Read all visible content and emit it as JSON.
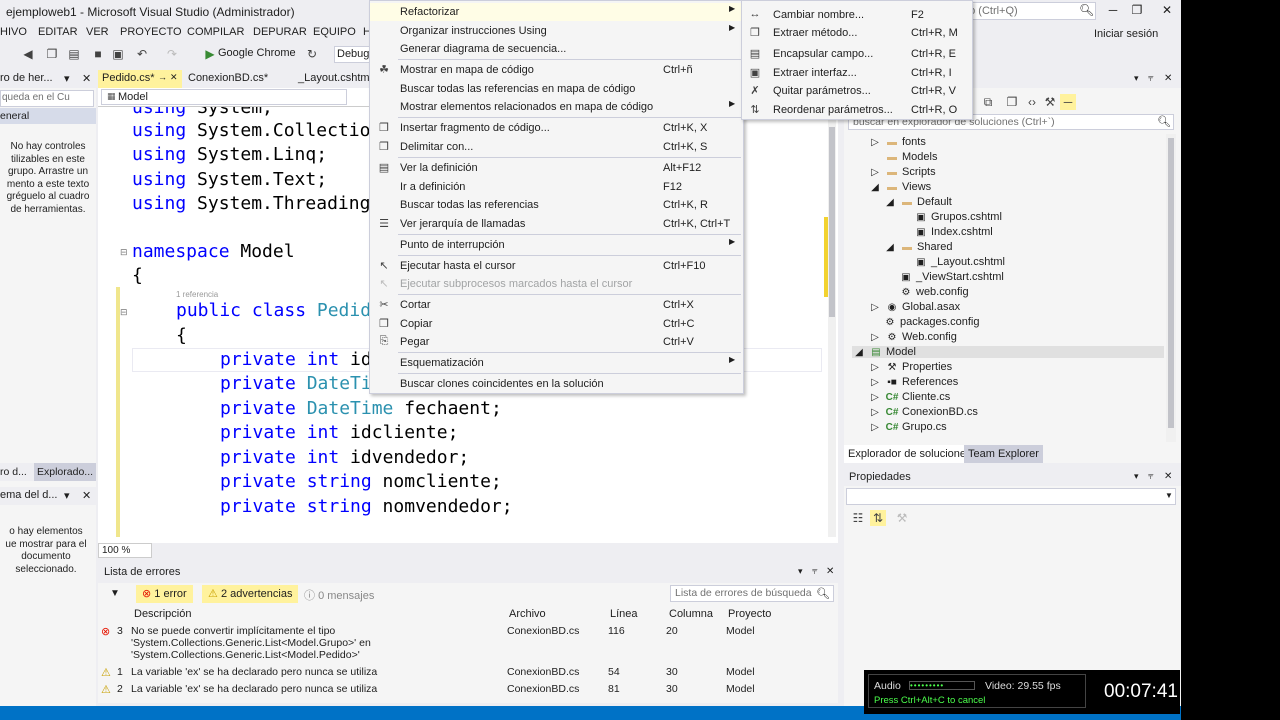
{
  "window": {
    "title": "ejemploweb1 - Microsoft Visual Studio (Administrador)",
    "quick_launch_placeholder": "do (Ctrl+Q)",
    "sign_in": "Iniciar sesión"
  },
  "menu": [
    "HIVO",
    "EDITAR",
    "VER",
    "PROYECTO",
    "COMPILAR",
    "DEPURAR",
    "EQUIPO",
    "H"
  ],
  "toolbar": {
    "browser": "Google Chrome",
    "config": "Debug"
  },
  "left_pane": {
    "toolbox_header": "ro de her...",
    "search_placeholder": "queda en el Cu",
    "general": "eneral",
    "empty_msg": [
      "No hay controles",
      "tilizables en este",
      "grupo. Arrastre un",
      "mento a este texto",
      "gréguelo al cuadro",
      "de herramientas."
    ],
    "tabs": [
      "ro d...",
      "Explorado..."
    ],
    "outline_header": "ema del d...",
    "outline_msg": [
      "o hay elementos",
      "ue mostrar para el",
      "documento",
      "seleccionado."
    ]
  },
  "doc_tabs": {
    "active": "Pedido.cs*",
    "tab2": "ConexionBD.cs*",
    "tab3": "_Layout.cshtml"
  },
  "navbar": {
    "project": "Model"
  },
  "code": {
    "lines": [
      {
        "kw": "using",
        "rest": " System;"
      },
      {
        "kw": "using",
        "rest": " System.Collectio"
      },
      {
        "kw": "using",
        "rest": " System.Linq;"
      },
      {
        "kw": "using",
        "rest": " System.Text;"
      },
      {
        "kw": "using",
        "rest": " System.Threading"
      },
      {
        "kw": "namespace",
        "rest": " Model"
      },
      {
        "kw": "",
        "rest": "{"
      },
      {
        "kw": "public class",
        "ty": " Pedid"
      },
      {
        "kw": "",
        "rest": "{"
      },
      {
        "kw": "private",
        "kw2": " int",
        "rest": " id"
      },
      {
        "kw": "private",
        "ty": " DateTi"
      },
      {
        "kw": "private",
        "ty": " DateTime",
        "rest": " fechaent;"
      },
      {
        "kw": "private",
        "kw2": " int",
        "rest": " idcliente;"
      },
      {
        "kw": "private",
        "kw2": " int",
        "rest": " idvendedor;"
      },
      {
        "kw": "private",
        "kw2": " string",
        "rest": " nomcliente;"
      },
      {
        "kw": "private",
        "kw2": " string",
        "rest": " nomvendedor;"
      }
    ],
    "ref_hint": "1 referencia"
  },
  "zoom": "100 %",
  "error_list": {
    "title": "Lista de errores",
    "errors_btn": "1 error",
    "warnings_btn": "2 advertencias",
    "messages_btn": "0 mensajes",
    "search_placeholder": "Lista de errores de búsqueda",
    "columns": [
      "Descripción",
      "Archivo",
      "Línea",
      "Columna",
      "Proyecto"
    ],
    "rows": [
      {
        "num": "3",
        "desc": [
          "No se puede convertir implícitamente el tipo",
          "'System.Collections.Generic.List<Model.Grupo>' en",
          "'System.Collections.Generic.List<Model.Pedido>'"
        ],
        "file": "ConexionBD.cs",
        "line": "116",
        "col": "20",
        "project": "Model"
      },
      {
        "num": "1",
        "desc": [
          "La variable 'ex' se ha declarado pero nunca se utiliza"
        ],
        "file": "ConexionBD.cs",
        "line": "54",
        "col": "30",
        "project": "Model"
      },
      {
        "num": "2",
        "desc": [
          "La variable 'ex' se ha declarado pero nunca se utiliza"
        ],
        "file": "ConexionBD.cs",
        "line": "81",
        "col": "30",
        "project": "Model"
      }
    ]
  },
  "solution_explorer": {
    "search_placeholder": "buscar en explorador de soluciones (Ctrl+`)",
    "items": [
      {
        "label": "fonts",
        "icon": "folder"
      },
      {
        "label": "Models",
        "icon": "folder"
      },
      {
        "label": "Scripts",
        "icon": "folder"
      },
      {
        "label": "Views",
        "icon": "folder"
      },
      {
        "label": "Default",
        "icon": "folder"
      },
      {
        "label": "Grupos.cshtml",
        "icon": "file"
      },
      {
        "label": "Index.cshtml",
        "icon": "file"
      },
      {
        "label": "Shared",
        "icon": "folder"
      },
      {
        "label": "_Layout.cshtml",
        "icon": "file"
      },
      {
        "label": "_ViewStart.cshtml",
        "icon": "file"
      },
      {
        "label": "web.config",
        "icon": "file"
      },
      {
        "label": "Global.asax",
        "icon": "file"
      },
      {
        "label": "packages.config",
        "icon": "file"
      },
      {
        "label": "Web.config",
        "icon": "file"
      },
      {
        "label": "Model",
        "icon": "project"
      },
      {
        "label": "Properties",
        "icon": "wrench"
      },
      {
        "label": "References",
        "icon": "refs"
      },
      {
        "label": "Cliente.cs",
        "icon": "cs"
      },
      {
        "label": "ConexionBD.cs",
        "icon": "cs"
      },
      {
        "label": "Grupo.cs",
        "icon": "cs"
      }
    ],
    "tabs": [
      "Explorador de soluciones",
      "Team Explorer"
    ]
  },
  "properties": {
    "title": "Propiedades"
  },
  "context_menu": {
    "items": [
      {
        "label": "Refactorizar",
        "shortcut": "",
        "submenu": true
      },
      {
        "label": "Organizar instrucciones Using",
        "shortcut": "",
        "submenu": true
      },
      {
        "label": "Generar diagrama de secuencia...",
        "shortcut": ""
      },
      {
        "label": "Mostrar en mapa de código",
        "shortcut": "Ctrl+ñ"
      },
      {
        "label": "Buscar todas las referencias en mapa de código",
        "shortcut": ""
      },
      {
        "label": "Mostrar elementos relacionados en mapa de código",
        "shortcut": "",
        "submenu": true
      },
      {
        "label": "Insertar fragmento de código...",
        "shortcut": "Ctrl+K, X"
      },
      {
        "label": "Delimitar con...",
        "shortcut": "Ctrl+K, S"
      },
      {
        "label": "Ver la definición",
        "shortcut": "Alt+F12"
      },
      {
        "label": "Ir a definición",
        "shortcut": "F12"
      },
      {
        "label": "Buscar todas las referencias",
        "shortcut": "Ctrl+K, R"
      },
      {
        "label": "Ver jerarquía de llamadas",
        "shortcut": "Ctrl+K, Ctrl+T"
      },
      {
        "label": "Punto de interrupción",
        "shortcut": "",
        "submenu": true
      },
      {
        "label": "Ejecutar hasta el cursor",
        "shortcut": "Ctrl+F10"
      },
      {
        "label": "Ejecutar subprocesos marcados hasta el cursor",
        "shortcut": "",
        "disabled": true
      },
      {
        "label": "Cortar",
        "shortcut": "Ctrl+X"
      },
      {
        "label": "Copiar",
        "shortcut": "Ctrl+C"
      },
      {
        "label": "Pegar",
        "shortcut": "Ctrl+V"
      },
      {
        "label": "Esquematización",
        "shortcut": "",
        "submenu": true
      },
      {
        "label": "Buscar clones coincidentes en la solución",
        "shortcut": ""
      }
    ]
  },
  "submenu": {
    "items": [
      {
        "label": "Cambiar nombre...",
        "shortcut": "F2"
      },
      {
        "label": "Extraer método...",
        "shortcut": "Ctrl+R, M"
      },
      {
        "label": "Encapsular campo...",
        "shortcut": "Ctrl+R, E"
      },
      {
        "label": "Extraer interfaz...",
        "shortcut": "Ctrl+R, I"
      },
      {
        "label": "Quitar parámetros...",
        "shortcut": "Ctrl+R, V"
      },
      {
        "label": "Reordenar parámetros...",
        "shortcut": "Ctrl+R, O"
      }
    ]
  },
  "recorder": {
    "audio": "Audio",
    "video": "Video: 29.55 fps",
    "hint": "Press Ctrl+Alt+C to cancel",
    "time": "00:07:41"
  },
  "colors": {
    "accent": "#0072c6",
    "active_tab": "#fff29d",
    "keyword": "#0000ff",
    "type": "#2b91af"
  }
}
